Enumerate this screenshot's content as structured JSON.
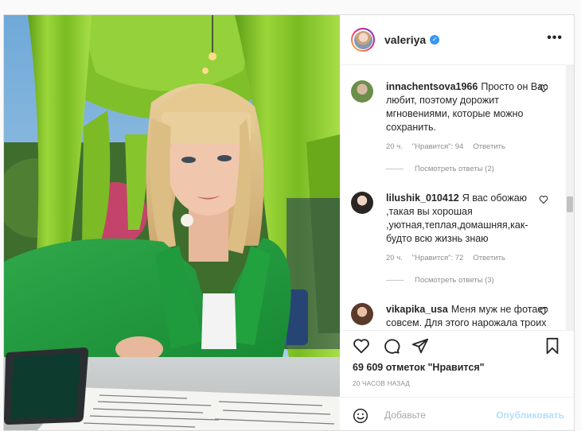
{
  "post": {
    "username": "valeriya",
    "verified": "✓",
    "more": "•••"
  },
  "comments": [
    {
      "user": "innachentsova1966",
      "text": "Просто он Вас любит, поэтому дорожит мгновениями, которые можно сохранить.",
      "time": "20 ч.",
      "likes": "\"Нравится\": 94",
      "reply": "Ответить",
      "view_replies": "Посмотреть ответы (2)"
    },
    {
      "user": "lilushik_010412",
      "text": "Я вас обожаю ,такая вы хорошая ,уютная,теплая,домашняя,как-будто всю жизнь знаю",
      "time": "20 ч.",
      "likes": "\"Нравится\": 72",
      "reply": "Ответить",
      "view_replies": "Посмотреть ответы (3)"
    },
    {
      "user": "vikapika_usa",
      "text": "Меня муж не фотает совсем. Для этого нарожала троих детей, они"
    }
  ],
  "footer": {
    "likes_count": "69 609 отметок \"Нравится\"",
    "time_ago": "20 часов назад",
    "comment_placeholder": "Добавьте",
    "publish": "Опубликовать"
  },
  "icons": [
    "heart-icon",
    "comment-icon",
    "share-icon",
    "bookmark-icon",
    "emoji-icon",
    "more-icon",
    "verified-icon"
  ],
  "colors": {
    "accent": "#3897f0",
    "publish_disabled": "#b2dffc",
    "muted": "#8e8e8e"
  }
}
